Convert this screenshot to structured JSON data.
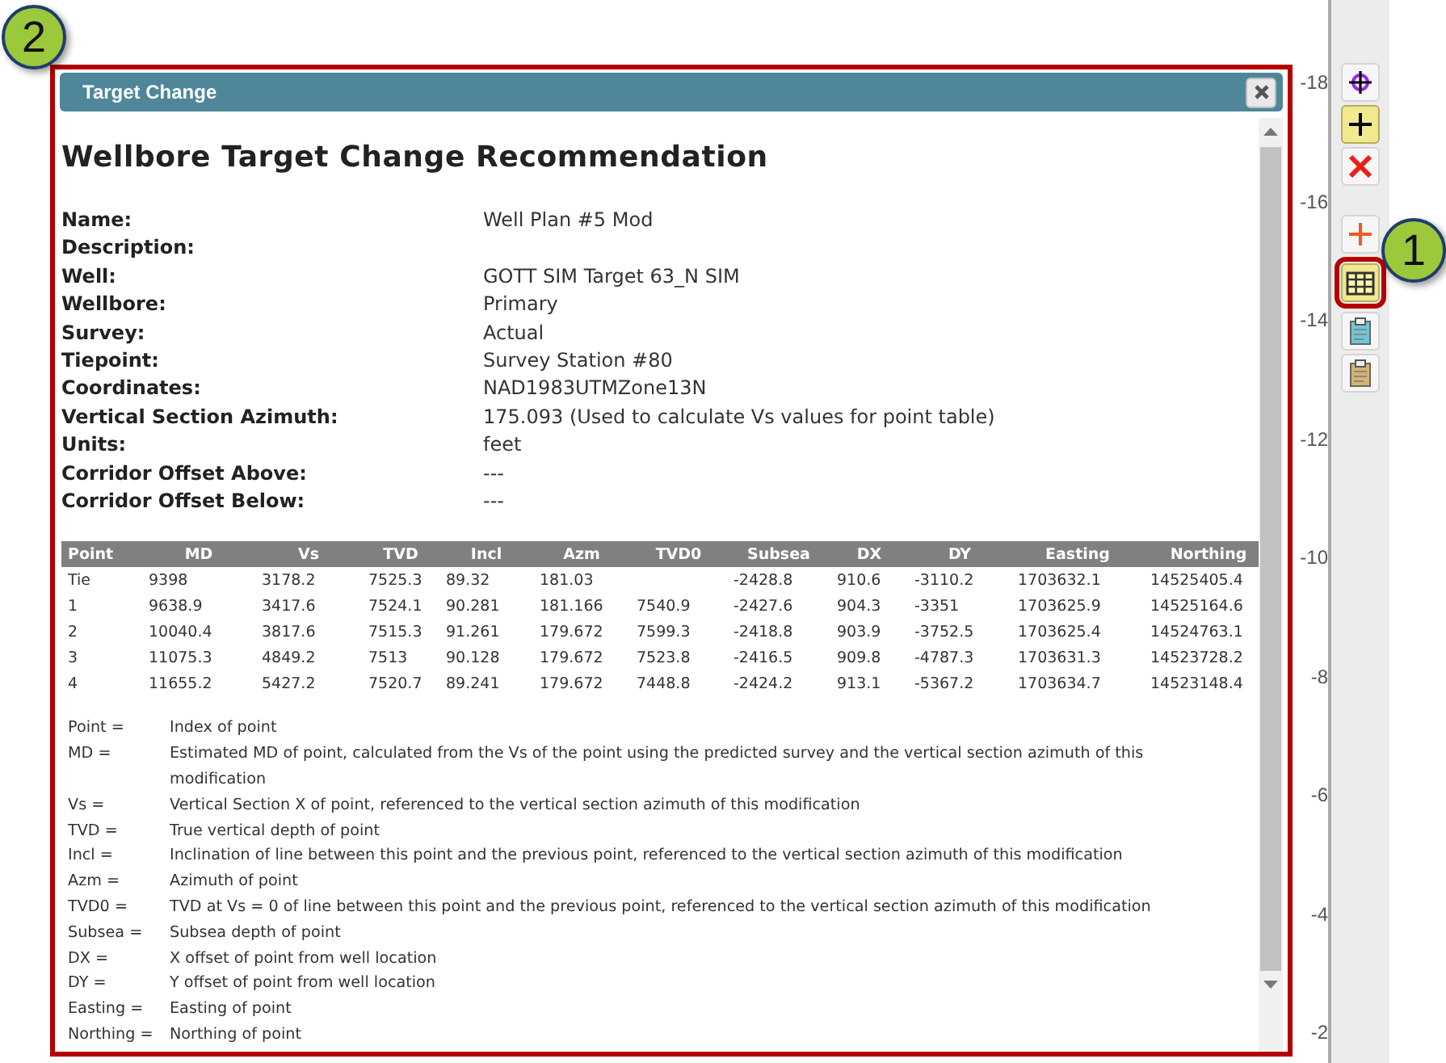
{
  "callouts": [
    {
      "number": "2"
    },
    {
      "number": "1"
    }
  ],
  "axis": {
    "ticks": [
      "-18",
      "-16",
      "-14",
      "-12",
      "-10",
      "-8",
      "-6",
      "-4",
      "-2"
    ]
  },
  "toolbar": [
    {
      "kind": "target",
      "selected": false
    },
    {
      "kind": "plus",
      "selected": true
    },
    {
      "kind": "delete",
      "selected": false
    },
    {
      "kind": "add",
      "selected": false
    },
    {
      "kind": "table",
      "selected": true
    },
    {
      "kind": "clipboard-blue",
      "selected": false
    },
    {
      "kind": "clipboard-tan",
      "selected": false
    }
  ],
  "dialog": {
    "title": "Target Change",
    "heading": "Wellbore Target Change Recommendation",
    "fields": [
      {
        "label": "Name:",
        "value": "Well Plan #5 Mod"
      },
      {
        "label": "Description:"
      },
      {
        "label": "Well:",
        "value": "GOTT SIM Target 63_N SIM"
      },
      {
        "label": "Wellbore:",
        "value": "Primary"
      },
      {
        "label": "Survey:",
        "value": "Actual"
      },
      {
        "label": "Tiepoint:",
        "value": "Survey Station #80"
      },
      {
        "label": "Coordinates:",
        "value": "NAD1983UTMZone13N"
      },
      {
        "label": "Vertical Section Azimuth:",
        "value": "175.093 (Used to calculate Vs values for point table)"
      },
      {
        "label": "Units:",
        "value": "feet"
      },
      {
        "label": "Corridor Offset Above:",
        "value": "---"
      },
      {
        "label": "Corridor Offset Below:",
        "value": "---"
      }
    ],
    "table": {
      "columns": [
        "Point",
        "MD",
        "Vs",
        "TVD",
        "Incl",
        "Azm",
        "TVD0",
        "Subsea",
        "DX",
        "DY",
        "Easting",
        "Northing"
      ],
      "rows": [
        [
          "Tie",
          "9398",
          "3178.2",
          "7525.3",
          "89.32",
          "181.03",
          "",
          "-2428.8",
          "910.6",
          "-3110.2",
          "1703632.1",
          "14525405.4"
        ],
        [
          "1",
          "9638.9",
          "3417.6",
          "7524.1",
          "90.281",
          "181.166",
          "7540.9",
          "-2427.6",
          "904.3",
          "-3351",
          "1703625.9",
          "14525164.6"
        ],
        [
          "2",
          "10040.4",
          "3817.6",
          "7515.3",
          "91.261",
          "179.672",
          "7599.3",
          "-2418.8",
          "903.9",
          "-3752.5",
          "1703625.4",
          "14524763.1"
        ],
        [
          "3",
          "11075.3",
          "4849.2",
          "7513",
          "90.128",
          "179.672",
          "7523.8",
          "-2416.5",
          "909.8",
          "-4787.3",
          "1703631.3",
          "14523728.2"
        ],
        [
          "4",
          "11655.2",
          "5427.2",
          "7520.7",
          "89.241",
          "179.672",
          "7448.8",
          "-2424.2",
          "913.1",
          "-5367.2",
          "1703634.7",
          "14523148.4"
        ]
      ]
    },
    "legend": [
      {
        "term": "Point =",
        "definition": "Index of point"
      },
      {
        "term": "MD =",
        "definition": "Estimated MD of point, calculated from the Vs of the point using the predicted survey and the vertical section azimuth of this modification"
      },
      {
        "term": "Vs =",
        "definition": "Vertical Section X of point, referenced to the vertical section azimuth of this modification"
      },
      {
        "term": "TVD =",
        "definition": "True vertical depth of point"
      },
      {
        "term": "Incl =",
        "definition": "Inclination of line between this point and the previous point, referenced to the vertical section azimuth of this modification"
      },
      {
        "term": "Azm =",
        "definition": "Azimuth of point"
      },
      {
        "term": "TVD0 =",
        "definition": "TVD at Vs = 0 of line between this point and the previous point, referenced to the vertical section azimuth of this modification"
      },
      {
        "term": "Subsea =",
        "definition": "Subsea depth of point"
      },
      {
        "term": "DX =",
        "definition": "X offset of point from well location"
      },
      {
        "term": "DY =",
        "definition": "Y offset of point from well location"
      },
      {
        "term": "Easting =",
        "definition": "Easting of point"
      },
      {
        "term": "Northing =",
        "definition": "Northing of point"
      }
    ]
  }
}
